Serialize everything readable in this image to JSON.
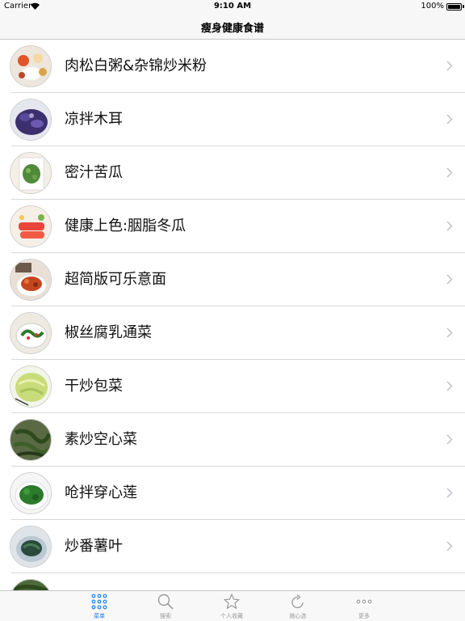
{
  "status_bar": {
    "carrier": "Carrier",
    "time": "9:10 AM",
    "battery": "100%"
  },
  "nav": {
    "title": "瘦身健康食谱"
  },
  "recipes": [
    {
      "title": "肉松白粥&杂锦炒米粉",
      "icon": "food-photo-icon"
    },
    {
      "title": "凉拌木耳",
      "icon": "food-photo-icon"
    },
    {
      "title": "密汁苦瓜",
      "icon": "food-photo-icon"
    },
    {
      "title": "健康上色:胭脂冬瓜",
      "icon": "food-photo-icon"
    },
    {
      "title": "超简版可乐意面",
      "icon": "food-photo-icon"
    },
    {
      "title": "椒丝腐乳通菜",
      "icon": "food-photo-icon"
    },
    {
      "title": "干炒包菜",
      "icon": "food-photo-icon"
    },
    {
      "title": "素炒空心菜",
      "icon": "food-photo-icon"
    },
    {
      "title": "呛拌穿心莲",
      "icon": "food-photo-icon"
    },
    {
      "title": "炒番薯叶",
      "icon": "food-photo-icon"
    },
    {
      "title": "",
      "icon": "food-photo-icon"
    }
  ],
  "tabs": [
    {
      "label": "菜单",
      "icon": "grid-icon",
      "active": true
    },
    {
      "label": "搜索",
      "icon": "search-icon",
      "active": false
    },
    {
      "label": "个人收藏",
      "icon": "star-icon",
      "active": false
    },
    {
      "label": "随心选",
      "icon": "refresh-icon",
      "active": false
    },
    {
      "label": "更多",
      "icon": "more-icon",
      "active": false
    }
  ],
  "colors": {
    "accent": "#1a7cf7",
    "inactive": "#9a9a9a",
    "separator": "#d9d9dc",
    "bar": "#f7f7f7"
  }
}
